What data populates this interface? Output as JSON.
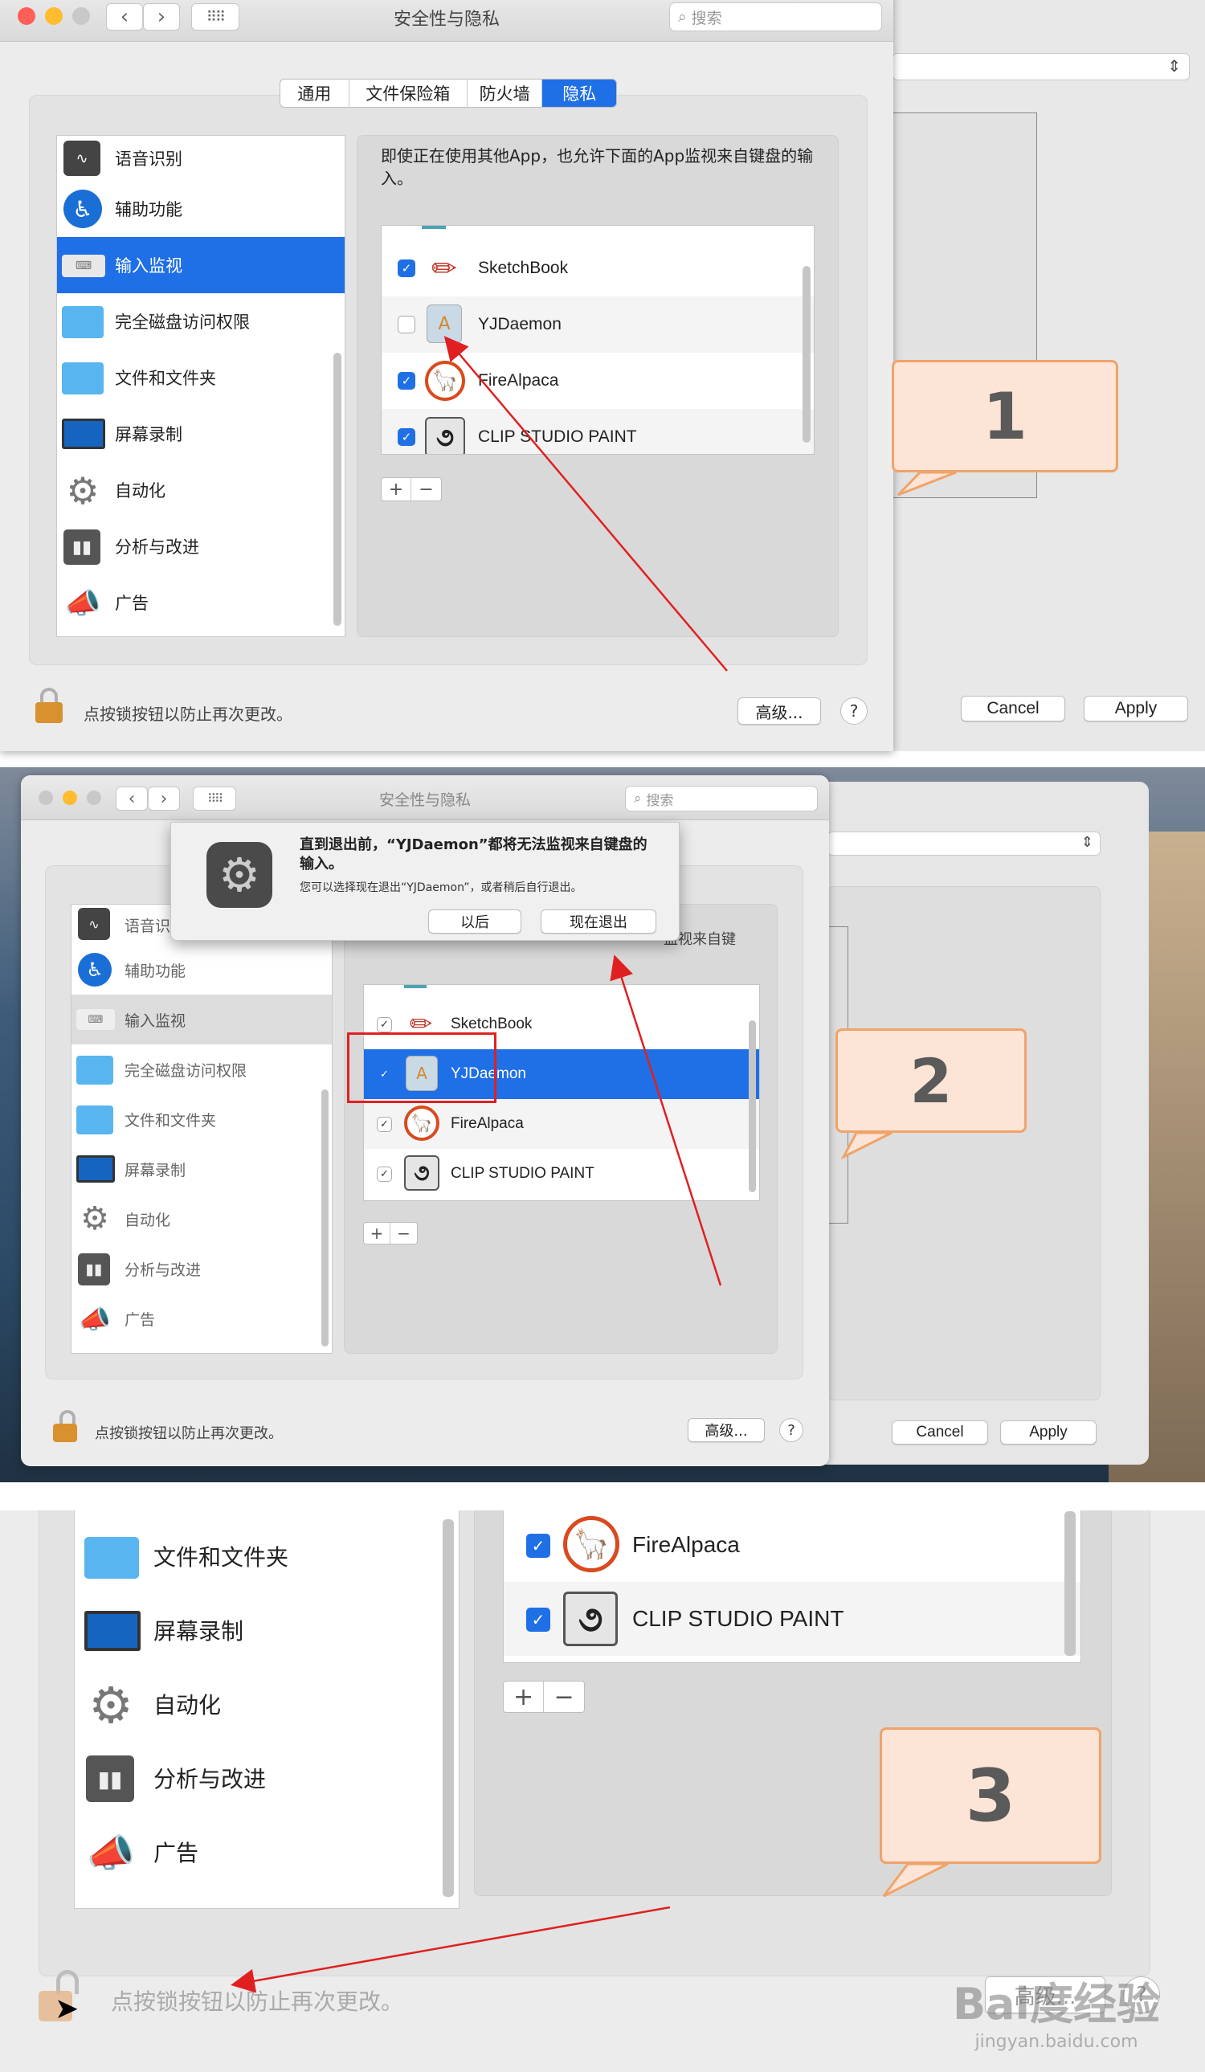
{
  "panel1": {
    "window_title": "安全性与隐私",
    "search_placeholder": "搜索",
    "tabs": [
      "通用",
      "文件保险箱",
      "防火墙",
      "隐私"
    ],
    "sidebar": [
      "语音识别",
      "辅助功能",
      "输入监视",
      "完全磁盘访问权限",
      "文件和文件夹",
      "屏幕录制",
      "自动化",
      "分析与改进",
      "广告"
    ],
    "description": "即使正在使用其他App，也允许下面的App监视来自键盘的输入。",
    "apps": [
      {
        "name": "SketchBook",
        "checked": true
      },
      {
        "name": "YJDaemon",
        "checked": false
      },
      {
        "name": "FireAlpaca",
        "checked": true
      },
      {
        "name": "CLIP STUDIO PAINT",
        "checked": true
      }
    ],
    "lock_text": "点按锁按钮以防止再次更改。",
    "advanced": "高级...",
    "help": "?",
    "cancel": "Cancel",
    "apply": "Apply",
    "plus": "+",
    "minus": "−",
    "callout": "1"
  },
  "panel2": {
    "window_title": "安全性与隐私",
    "search_placeholder": "搜索",
    "dialog_title": "直到退出前，“YJDaemon”都将无法监视来自键盘的输入。",
    "dialog_body": "您可以选择现在退出“YJDaemon”，或者稍后自行退出。",
    "later": "以后",
    "quit_now": "现在退出",
    "desc_partial": "监视来自键",
    "sidebar": [
      "语音识",
      "辅助功能",
      "输入监视",
      "完全磁盘访问权限",
      "文件和文件夹",
      "屏幕录制",
      "自动化",
      "分析与改进",
      "广告"
    ],
    "apps": [
      {
        "name": "SketchBook",
        "checked": true
      },
      {
        "name": "YJDaemon",
        "checked": true
      },
      {
        "name": "FireAlpaca",
        "checked": true
      },
      {
        "name": "CLIP STUDIO PAINT",
        "checked": true
      }
    ],
    "lock_text": "点按锁按钮以防止再次更改。",
    "advanced": "高级...",
    "help": "?",
    "cancel": "Cancel",
    "apply": "Apply",
    "plus": "+",
    "minus": "−",
    "callout": "2"
  },
  "panel3": {
    "sidebar": [
      "文件和文件夹",
      "屏幕录制",
      "自动化",
      "分析与改进",
      "广告"
    ],
    "apps": [
      {
        "name": "FireAlpaca",
        "checked": true
      },
      {
        "name": "CLIP STUDIO PAINT",
        "checked": true
      }
    ],
    "lock_text": "点按锁按钮以防止再次更改。",
    "advanced_partial": "高级...",
    "help": "?",
    "plus": "+",
    "minus": "−",
    "callout": "3",
    "watermark": "Bai度经验",
    "watermark_url": "jingyan.baidu.com"
  },
  "colors": {
    "accent": "#1f6fe6",
    "arrow": "#e02020",
    "callout_fill": "#fce4d6",
    "callout_border": "#f0a36a"
  }
}
